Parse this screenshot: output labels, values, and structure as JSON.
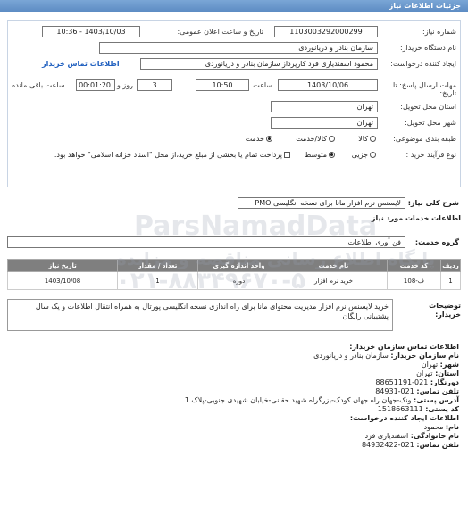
{
  "page_title": "جزئیات اطلاعات نیاز",
  "fields": {
    "need_number_label": "شماره نیاز:",
    "need_number": "1103003292000299",
    "announce_label": "تاریخ و ساعت اعلان عمومی:",
    "announce_value": "1403/10/03 - 10:36",
    "buyer_label": "نام دستگاه خریدار:",
    "buyer_value": "سازمان بنادر و دریانوردی",
    "creator_label": "ایجاد کننده درخواست:",
    "creator_value": "محمود اسفندیاری فرد کارپرداز سازمان بنادر و دریانوردی",
    "contact_link": "اطلاعات تماس خریدار",
    "deadline_label": "مهلت ارسال پاسخ: تا تاریخ:",
    "deadline_date": "1403/10/06",
    "time_word": "ساعت",
    "deadline_time": "10:50",
    "days_value": "3",
    "day_word": "روز و",
    "remaining_time": "00:01:20",
    "remaining_label": "ساعت باقی مانده",
    "delivery_province_label": "استان محل تحویل:",
    "delivery_province": "تهران",
    "delivery_city_label": "شهر محل تحویل:",
    "delivery_city": "تهران",
    "category_label": "طبقه بندی موضوعی:",
    "category_options": [
      "کالا",
      "کالا/خدمت",
      "خدمت"
    ],
    "purchase_label": "نوع فرآیند خرید :",
    "purchase_options": [
      "جزیی",
      "متوسط"
    ],
    "payment_note": "پرداخت تمام یا بخشی از مبلغ خرید،از محل \"اسناد خزانه اسلامی\" خواهد بود."
  },
  "summary": {
    "label": "شرح کلی نیاز:",
    "value": "لایسنس نرم افزار مانا برای نسخه انگلیسی PMO"
  },
  "services": {
    "title": "اطلاعات خدمات مورد نیاز",
    "group_label": "گروه خدمت:",
    "group_value": "فن آوری اطلاعات",
    "headers": [
      "ردیف",
      "کد خدمت",
      "نام خدمت",
      "واحد اندازه گیری",
      "تعداد / مقدار",
      "تاریخ نیاز"
    ],
    "rows": [
      [
        "1",
        "ف-108",
        "خرید نرم افزار",
        "دوره",
        "1",
        "1403/10/08"
      ]
    ]
  },
  "buyer_description": {
    "label": "توضیحات خریدار:",
    "value": "خرید لایسنس نرم افزار مدیریت محتوای مانا برای راه اندازی نسخه انگلیسی پورتال به همراه انتقال اطلاعات و یک سال پشتیبانی رایگان"
  },
  "contact": {
    "title": "اطلاعات تماس سازمان خریدار:",
    "org_label": "نام سازمان خریدار:",
    "org_value": "سازمان بنادر و دریانوردی",
    "city_label": "شهر:",
    "city_value": "تهران",
    "province_label": "استان:",
    "province_value": "تهران",
    "fax_label": "دورنگار:",
    "fax_value": "021-88651191",
    "phone_label": "تلفن تماس:",
    "phone_value": "021-84931",
    "address_label": "آدرس پستی:",
    "address_value": "ونک-جهان راه جهان کودک-بزرگراه شهید حقانی-خیابان شهیدی جنوبی-پلاک 1",
    "postal_label": "کد پستی:",
    "postal_value": "1518663111",
    "creator_title": "اطلاعات ایجاد کننده درخواست:",
    "first_name_label": "نام:",
    "first_name_value": "محمود",
    "last_name_label": "نام خانوادگی:",
    "last_name_value": "اسفندیاری فرد",
    "creator_phone_label": "تلفن تماس:",
    "creator_phone_value": "021-84932422"
  },
  "watermark": {
    "line1": "ParsNamadData",
    "line2": "پایگاه اطلاع رسانی مناقصه و مزایده",
    "line3": "۰۲۱-۸۸۳۴۹۶۷۰-۵"
  }
}
